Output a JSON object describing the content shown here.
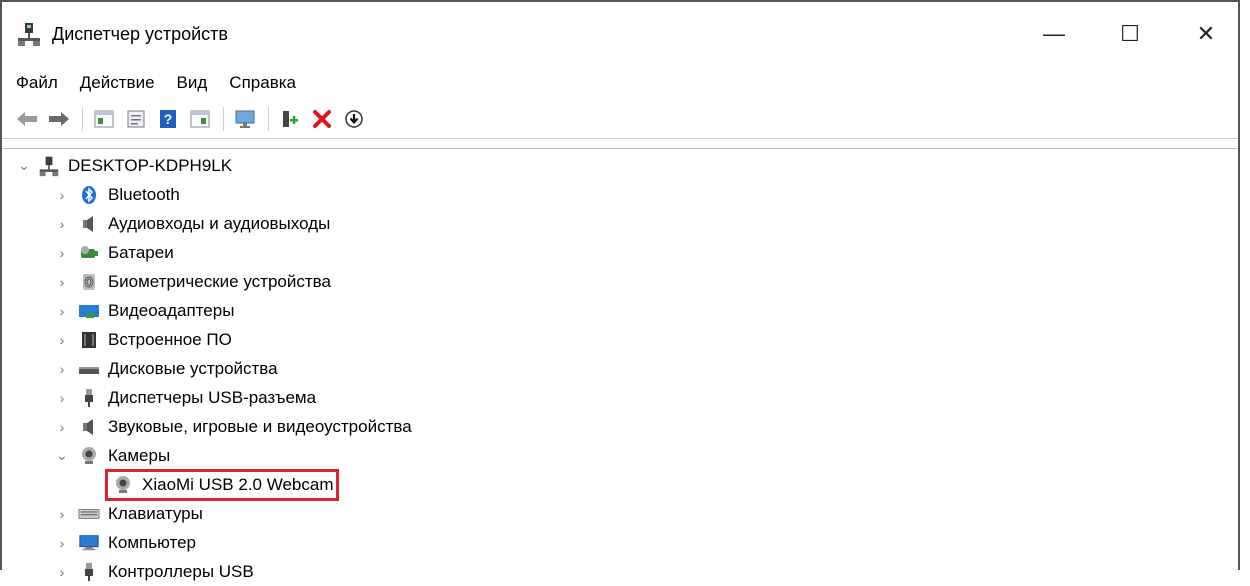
{
  "window": {
    "title": "Диспетчер устройств",
    "minimize": "—",
    "maximize": "☐",
    "close": "✕"
  },
  "menu": [
    "Файл",
    "Действие",
    "Вид",
    "Справка"
  ],
  "toolbar_icons": [
    "back-icon",
    "forward-icon",
    "properties-grid-icon",
    "document-icon",
    "help-icon",
    "view-icon",
    "monitor-icon",
    "add-device-icon",
    "remove-icon",
    "download-icon"
  ],
  "tree": {
    "root": "DESKTOP-KDPH9LK",
    "items": [
      {
        "label": "Bluetooth",
        "icon": "bluetooth-icon",
        "expanded": false
      },
      {
        "label": "Аудиовходы и аудиовыходы",
        "icon": "speaker-icon",
        "expanded": false
      },
      {
        "label": "Батареи",
        "icon": "battery-icon",
        "expanded": false
      },
      {
        "label": "Биометрические устройства",
        "icon": "fingerprint-icon",
        "expanded": false
      },
      {
        "label": "Видеоадаптеры",
        "icon": "display-adapter-icon",
        "expanded": false
      },
      {
        "label": "Встроенное ПО",
        "icon": "chip-icon",
        "expanded": false
      },
      {
        "label": "Дисковые устройства",
        "icon": "disk-icon",
        "expanded": false
      },
      {
        "label": "Диспетчеры USB-разъема",
        "icon": "usb-plug-icon",
        "expanded": false
      },
      {
        "label": "Звуковые, игровые и видеоустройства",
        "icon": "speaker-icon",
        "expanded": false
      },
      {
        "label": "Камеры",
        "icon": "webcam-icon",
        "expanded": true,
        "children": [
          {
            "label": "XiaoMi USB 2.0 Webcam",
            "icon": "webcam-icon",
            "highlighted": true
          }
        ]
      },
      {
        "label": "Клавиатуры",
        "icon": "keyboard-icon",
        "expanded": false
      },
      {
        "label": "Компьютер",
        "icon": "computer-icon",
        "expanded": false
      },
      {
        "label": "Контроллеры USB",
        "icon": "usb-plug-icon",
        "expanded": false
      }
    ]
  },
  "colors": {
    "highlight_border": "#d9232e",
    "remove_red": "#e0141b",
    "help_blue": "#1f5fbf"
  }
}
